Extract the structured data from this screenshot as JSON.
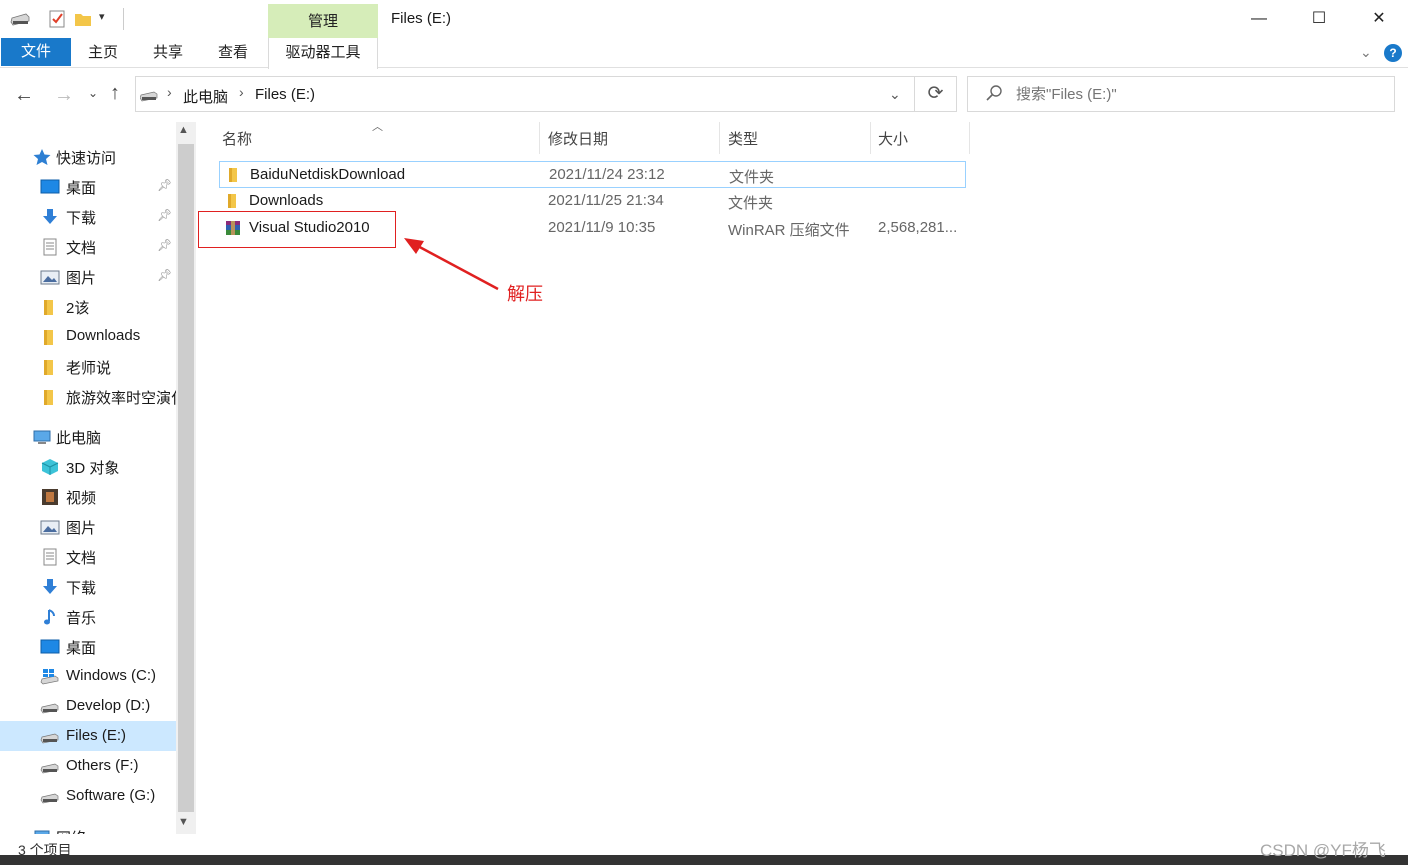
{
  "window": {
    "title": "Files (E:)",
    "minimize": "—",
    "maximize": "☐",
    "close": "✕"
  },
  "ribbon": {
    "contextual_group": "管理",
    "tabs": {
      "file": "文件",
      "home": "主页",
      "share": "共享",
      "view": "查看",
      "drive_tools": "驱动器工具"
    },
    "help": "?",
    "expand": "⌄"
  },
  "address": {
    "crumbs": [
      "此电脑",
      "Files (E:)"
    ],
    "separator": "›"
  },
  "search": {
    "placeholder": "搜索\"Files (E:)\""
  },
  "nav": {
    "quick_access": {
      "label": "快速访问",
      "items": [
        {
          "label": "桌面",
          "icon": "desktop-icon",
          "pinned": true
        },
        {
          "label": "下载",
          "icon": "download-icon",
          "pinned": true
        },
        {
          "label": "文档",
          "icon": "document-icon",
          "pinned": true
        },
        {
          "label": "图片",
          "icon": "pictures-icon",
          "pinned": true
        },
        {
          "label": "2该",
          "icon": "folder-icon",
          "pinned": false
        },
        {
          "label": "Downloads",
          "icon": "folder-icon",
          "pinned": false
        },
        {
          "label": "老师说",
          "icon": "folder-icon",
          "pinned": false
        },
        {
          "label": "旅游效率时空演化",
          "icon": "folder-icon",
          "pinned": false
        }
      ]
    },
    "this_pc": {
      "label": "此电脑",
      "items": [
        {
          "label": "3D 对象",
          "icon": "3d-objects-icon"
        },
        {
          "label": "视频",
          "icon": "video-icon"
        },
        {
          "label": "图片",
          "icon": "pictures-icon"
        },
        {
          "label": "文档",
          "icon": "document-icon"
        },
        {
          "label": "下载",
          "icon": "download-icon"
        },
        {
          "label": "音乐",
          "icon": "music-icon"
        },
        {
          "label": "桌面",
          "icon": "desktop-icon"
        },
        {
          "label": "Windows (C:)",
          "icon": "windows-drive-icon"
        },
        {
          "label": "Develop (D:)",
          "icon": "drive-icon"
        },
        {
          "label": "Files (E:)",
          "icon": "drive-icon",
          "selected": true
        },
        {
          "label": "Others (F:)",
          "icon": "drive-icon"
        },
        {
          "label": "Software (G:)",
          "icon": "drive-icon"
        }
      ]
    },
    "network": {
      "label": "网络"
    }
  },
  "columns": {
    "name": "名称",
    "date": "修改日期",
    "type": "类型",
    "size": "大小"
  },
  "files": [
    {
      "name": "BaiduNetdiskDownload",
      "date": "2021/11/24 23:12",
      "type": "文件夹",
      "size": "",
      "icon": "folder-icon"
    },
    {
      "name": "Downloads",
      "date": "2021/11/25 21:34",
      "type": "文件夹",
      "size": "",
      "icon": "folder-icon"
    },
    {
      "name": "Visual Studio2010",
      "date": "2021/11/9 10:35",
      "type": "WinRAR 压缩文件",
      "size": "2,568,281...",
      "icon": "winrar-archive-icon"
    }
  ],
  "annotation": {
    "label": "解压",
    "color": "#e02020"
  },
  "status": {
    "count": "3 个项目"
  },
  "watermark": "CSDN @YF杨飞",
  "colors": {
    "accent": "#1979ca",
    "manage_tab": "#d6edb9",
    "selection": "#cce8ff",
    "folder": "#f3c649"
  }
}
